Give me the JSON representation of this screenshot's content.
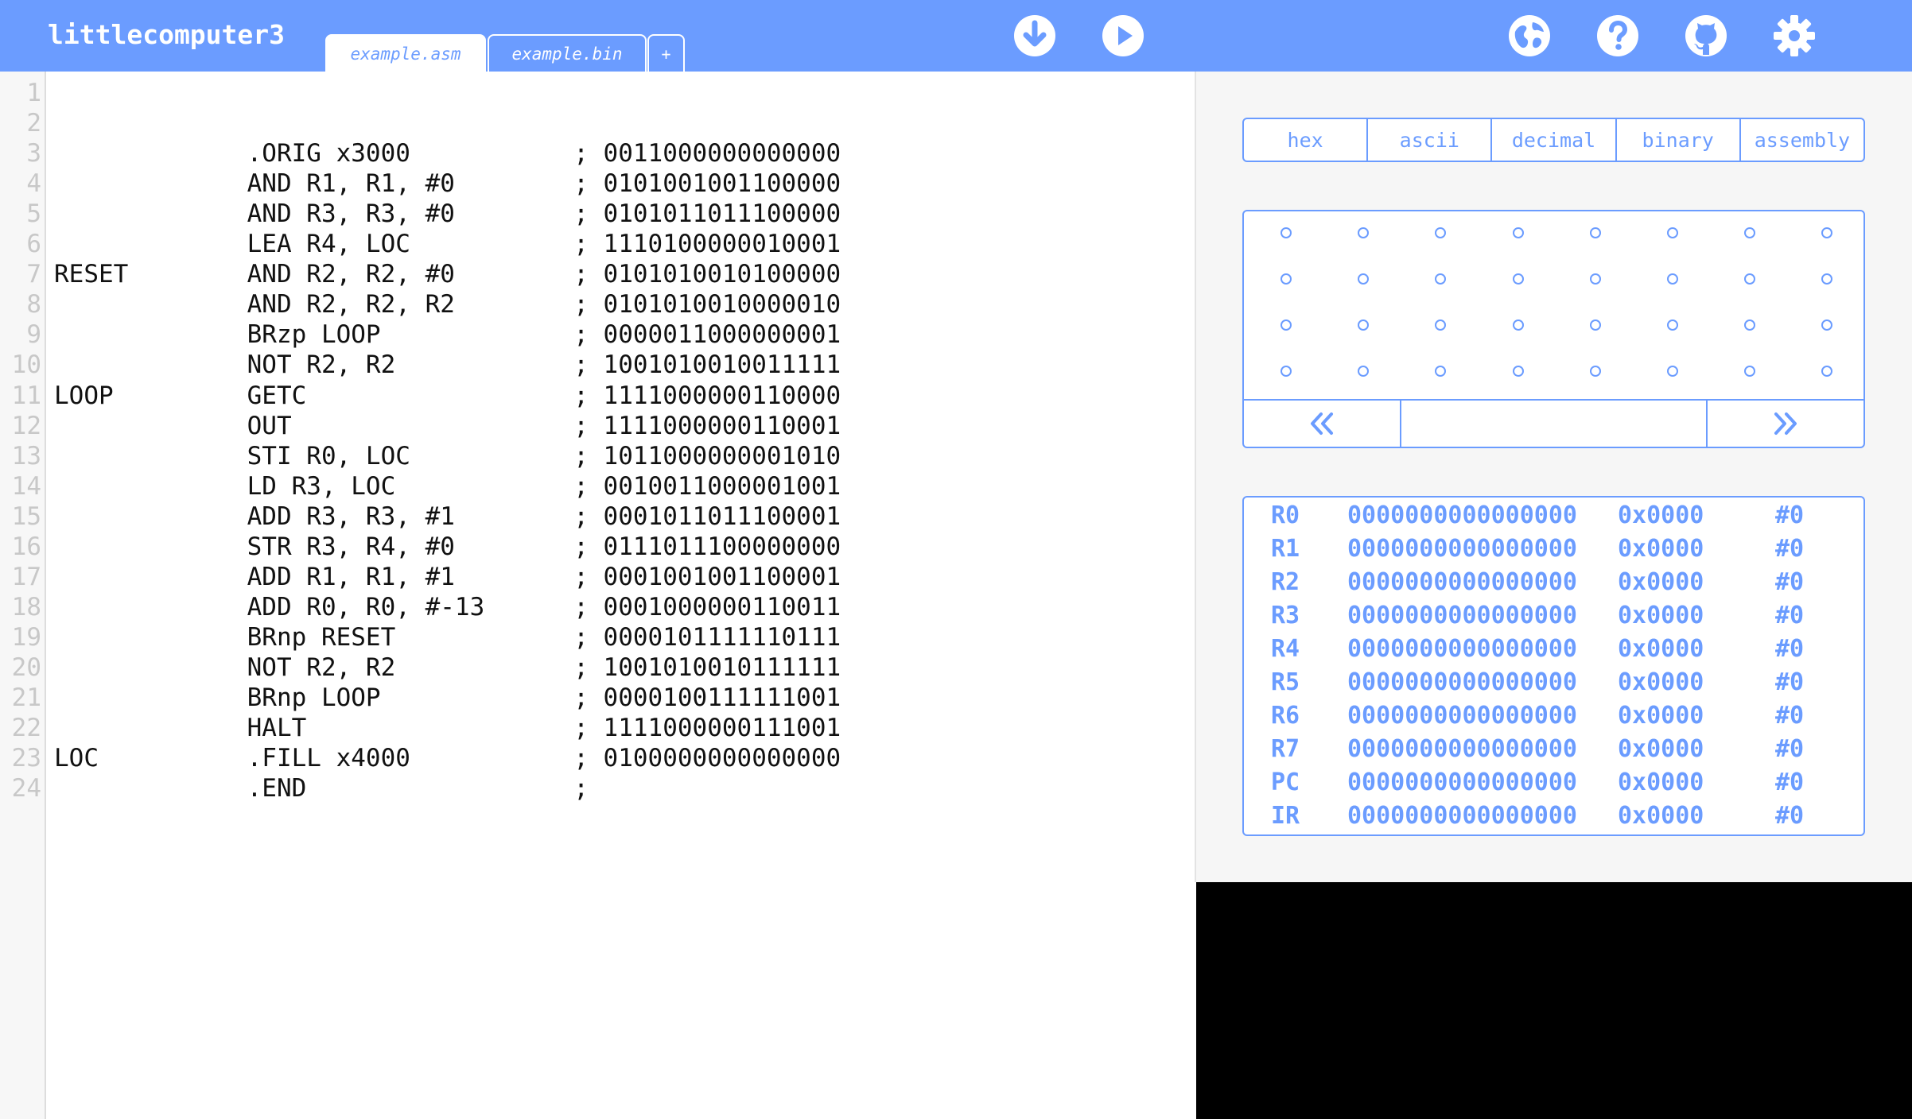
{
  "header": {
    "title": "littlecomputer3",
    "tabs": [
      {
        "label": "example.asm",
        "active": true
      },
      {
        "label": "example.bin",
        "active": false
      }
    ],
    "add_tab_label": "+",
    "icons": [
      "download-icon",
      "run-icon",
      "globe-icon",
      "help-icon",
      "github-icon",
      "settings-icon"
    ]
  },
  "editor": {
    "line_numbers": [
      "1",
      "2",
      "3",
      "4",
      "5",
      "6",
      "7",
      "8",
      "9",
      "10",
      "11",
      "12",
      "13",
      "14",
      "15",
      "16",
      "17",
      "18",
      "19",
      "20",
      "21",
      "22",
      "23",
      "24"
    ],
    "lines": [
      "",
      "",
      "             .ORIG x3000           ; 0011000000000000",
      "             AND R1, R1, #0        ; 0101001001100000",
      "             AND R3, R3, #0        ; 0101011011100000",
      "             LEA R4, LOC           ; 1110100000010001",
      "RESET        AND R2, R2, #0        ; 0101010010100000",
      "             AND R2, R2, R2        ; 0101010010000010",
      "             BRzp LOOP             ; 0000011000000001",
      "             NOT R2, R2            ; 1001010010011111",
      "LOOP         GETC                  ; 1111000000110000",
      "             OUT                   ; 1111000000110001",
      "             STI R0, LOC           ; 1011000000001010",
      "             LD R3, LOC            ; 0010011000001001",
      "             ADD R3, R3, #1        ; 0001011011100001",
      "             STR R3, R4, #0        ; 0111011100000000",
      "             ADD R1, R1, #1        ; 0001001001100001",
      "             ADD R0, R0, #-13      ; 0001000000110011",
      "             BRnp RESET            ; 0000101111110111",
      "             NOT R2, R2            ; 1001010010111111",
      "             BRnp LOOP             ; 0000100111111001",
      "             HALT                  ; 1111000000111001",
      "LOC          .FILL x4000           ; 0100000000000000",
      "             .END                  ;"
    ]
  },
  "formats": [
    "hex",
    "ascii",
    "decimal",
    "binary",
    "assembly"
  ],
  "memory": {
    "rows": 4,
    "cols": 8,
    "prev_icon": "double-chevron-left-icon",
    "next_icon": "double-chevron-right-icon",
    "address_value": ""
  },
  "registers": [
    {
      "name": "R0",
      "bin": "0000000000000000",
      "hex": "0x0000",
      "dec": "#0"
    },
    {
      "name": "R1",
      "bin": "0000000000000000",
      "hex": "0x0000",
      "dec": "#0"
    },
    {
      "name": "R2",
      "bin": "0000000000000000",
      "hex": "0x0000",
      "dec": "#0"
    },
    {
      "name": "R3",
      "bin": "0000000000000000",
      "hex": "0x0000",
      "dec": "#0"
    },
    {
      "name": "R4",
      "bin": "0000000000000000",
      "hex": "0x0000",
      "dec": "#0"
    },
    {
      "name": "R5",
      "bin": "0000000000000000",
      "hex": "0x0000",
      "dec": "#0"
    },
    {
      "name": "R6",
      "bin": "0000000000000000",
      "hex": "0x0000",
      "dec": "#0"
    },
    {
      "name": "R7",
      "bin": "0000000000000000",
      "hex": "0x0000",
      "dec": "#0"
    },
    {
      "name": "PC",
      "bin": "0000000000000000",
      "hex": "0x0000",
      "dec": "#0"
    },
    {
      "name": "IR",
      "bin": "0000000000000000",
      "hex": "0x0000",
      "dec": "#0"
    }
  ],
  "colors": {
    "accent": "#6b9cff",
    "console_bg": "#000000"
  }
}
